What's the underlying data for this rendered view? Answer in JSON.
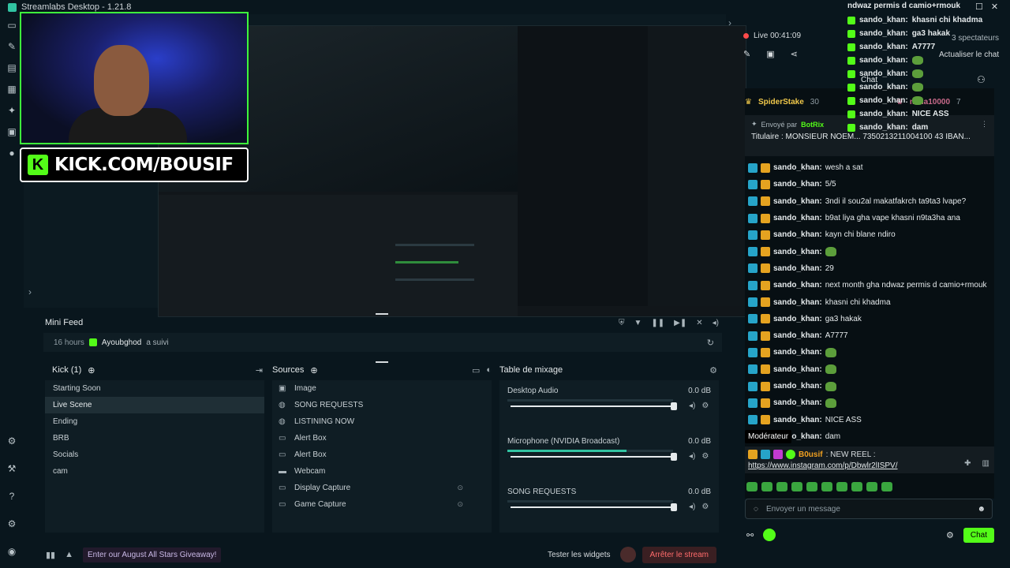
{
  "app": {
    "title": "Streamlabs Desktop - 1.21.8"
  },
  "banner": {
    "text": "KICK.COM/BOUSIF"
  },
  "minifeed": {
    "title": "Mini Feed",
    "event": {
      "time": "16 hours",
      "user": "Ayoubghod",
      "action": "a suivi"
    }
  },
  "scenes": {
    "header": "Kick (1)",
    "items": [
      "Starting Soon",
      "Live Scene",
      "Ending",
      "BRB",
      "Socials",
      "cam"
    ],
    "active_index": 1
  },
  "sources": {
    "header": "Sources",
    "items": [
      "Image",
      "SONG REQUESTS",
      "LISTINING NOW",
      "Alert Box",
      "Alert Box",
      "Webcam",
      "Display Capture",
      "Game Capture"
    ]
  },
  "mixer": {
    "header": "Table de mixage",
    "channels": [
      {
        "name": "Desktop Audio",
        "db": "0.0 dB",
        "meter_level": 0.0,
        "volume": 1.0
      },
      {
        "name": "Microphone (NVIDIA Broadcast)",
        "db": "0.0 dB",
        "meter_level": 0.72,
        "volume": 1.0
      },
      {
        "name": "SONG REQUESTS",
        "db": "0.0 dB",
        "meter_level": 0.0,
        "volume": 1.0
      }
    ]
  },
  "footer": {
    "giveaway": "Enter our August All Stars Giveaway!",
    "test_widgets": "Tester les widgets",
    "stop_stream": "Arrêter le stream"
  },
  "chat": {
    "live": "Live 00:41:09",
    "spectators": "3 spectateurs",
    "refresh": "Actualiser le chat",
    "tab_label": "Chat",
    "leaderboard": [
      {
        "name": "SpiderStake",
        "count": "30"
      },
      {
        "name": "mma10000",
        "count": "7"
      }
    ],
    "pinned": {
      "sent_by_label": "Envoyé par",
      "sent_by_name": "BotRix",
      "text": "Titulaire : MONSIEUR NOEM... 7350213211004100 43 IBAN..."
    },
    "messages": [
      {
        "user": "sando_khan:",
        "text": "wesh a sat",
        "emote": false
      },
      {
        "user": "sando_khan:",
        "text": "5/5",
        "emote": false
      },
      {
        "user": "sando_khan:",
        "text": "3ndi il sou2al makatfakrch ta9ta3 lvape?",
        "emote": false
      },
      {
        "user": "sando_khan:",
        "text": "b9at liya gha vape khasni n9ta3ha ana",
        "emote": false
      },
      {
        "user": "sando_khan:",
        "text": "kayn chi blane ndiro",
        "emote": false
      },
      {
        "user": "sando_khan:",
        "text": "",
        "emote": true
      },
      {
        "user": "sando_khan:",
        "text": "29",
        "emote": false
      },
      {
        "user": "sando_khan:",
        "text": "next month gha ndwaz permis d camio+rmouk",
        "emote": false
      },
      {
        "user": "sando_khan:",
        "text": "khasni chi khadma",
        "emote": false
      },
      {
        "user": "sando_khan:",
        "text": "ga3 hakak",
        "emote": false
      },
      {
        "user": "sando_khan:",
        "text": "A7777",
        "emote": false
      },
      {
        "user": "sando_khan:",
        "text": "",
        "emote": true
      },
      {
        "user": "sando_khan:",
        "text": "",
        "emote": true
      },
      {
        "user": "sando_khan:",
        "text": "",
        "emote": true
      },
      {
        "user": "sando_khan:",
        "text": "",
        "emote": true
      },
      {
        "user": "sando_khan:",
        "text": "NICE ASS",
        "emote": false
      },
      {
        "user": "sando_khan:",
        "text": "dam",
        "emote": false
      }
    ],
    "tooltip": "Modérateur",
    "reel": {
      "user": "B0usif",
      "text": ": NEW REEL :",
      "link": "https://www.instagram.com/p/Dbwlr2lISPV/"
    },
    "input_placeholder": "Envoyer un message",
    "send_label": "Chat"
  },
  "overlay_chat": {
    "title": "ndwaz permis d camio+rmouk",
    "lines": [
      {
        "user": "sando_khan:",
        "text": "khasni chi khadma"
      },
      {
        "user": "sando_khan:",
        "text": "ga3 hakak"
      },
      {
        "user": "sando_khan:",
        "text": "A7777"
      },
      {
        "user": "sando_khan:",
        "text": ""
      },
      {
        "user": "sando_khan:",
        "text": ""
      },
      {
        "user": "sando_khan:",
        "text": ""
      },
      {
        "user": "sando_khan:",
        "text": ""
      },
      {
        "user": "sando_khan:",
        "text": "NICE ASS"
      },
      {
        "user": "sando_khan:",
        "text": "dam"
      }
    ]
  }
}
